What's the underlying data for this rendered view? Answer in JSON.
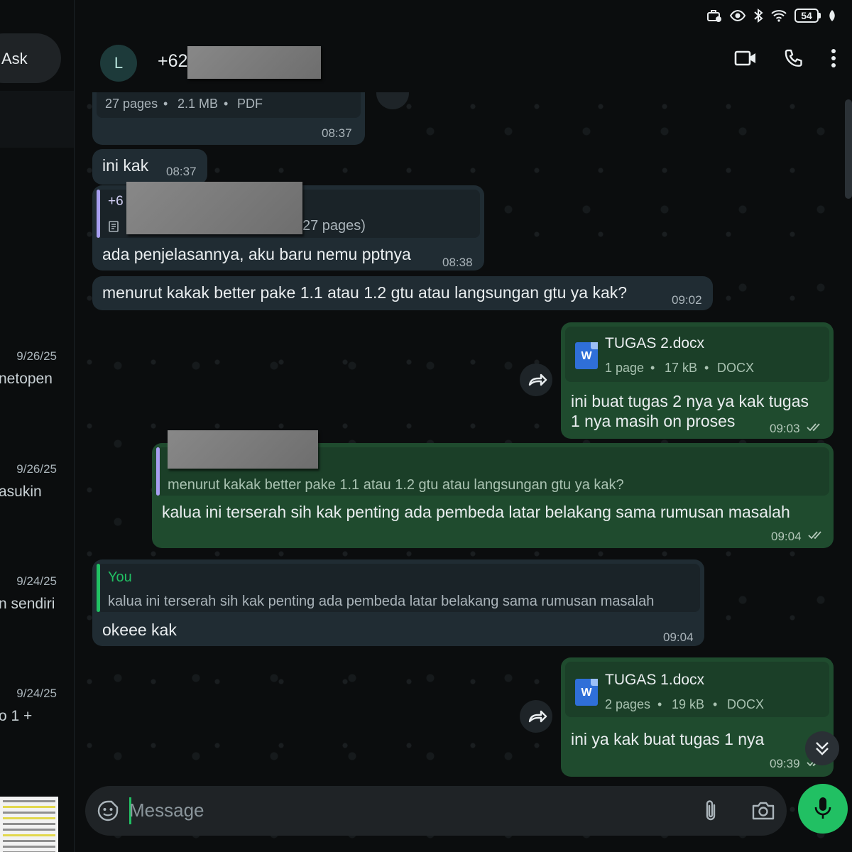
{
  "status_bar": {
    "battery": "54"
  },
  "left_panel": {
    "ask_label": "Ask",
    "chats": [
      {
        "date": "9/26/25",
        "preview": "netopen"
      },
      {
        "date": "9/26/25",
        "preview": "asukin"
      },
      {
        "date": "9/24/25",
        "preview": "n sendiri"
      },
      {
        "date": "9/24/25",
        "preview": "o 1 +"
      }
    ]
  },
  "header": {
    "avatar_letter": "L",
    "contact_name": "+62",
    "icons": [
      "video-call-icon",
      "voice-call-icon",
      "more-options-icon"
    ]
  },
  "messages": {
    "pdf_meta": {
      "pages": "27 pages",
      "size": "2.1 MB",
      "type": "PDF",
      "time": "08:37"
    },
    "ini_kak": {
      "text": "ini kak",
      "time": "08:37"
    },
    "reply_pptnya": {
      "quote_name": "+6",
      "quote_text": "27 pages)",
      "text": "ada penjelasannya, aku baru nemu pptnya",
      "time": "08:38"
    },
    "question": {
      "text": "menurut kakak better pake 1.1 atau 1.2 gtu atau langsungan gtu ya kak?",
      "time": "09:02"
    },
    "tugas2": {
      "file": "TUGAS 2.docx",
      "pages": "1 page",
      "size": "17 kB",
      "type": "DOCX",
      "text_line1": "ini buat tugas 2 nya ya kak tugas",
      "text_line2": "1 nya masih on proses",
      "time": "09:03"
    },
    "reply_terserah": {
      "quote_text": "menurut kakak better pake 1.1 atau 1.2 gtu atau langsungan gtu ya kak?",
      "text": "kalua ini terserah sih kak penting ada pembeda latar belakang sama rumusan masalah",
      "time": "09:04"
    },
    "okeee": {
      "quote_name": "You",
      "quote_text": "kalua ini terserah sih kak penting ada pembeda latar belakang sama rumusan masalah",
      "text": "okeee kak",
      "time": "09:04"
    },
    "tugas1": {
      "file": "TUGAS 1.docx",
      "pages": "2 pages",
      "size": "19 kB",
      "type": "DOCX",
      "text": "ini ya kak buat tugas 1 nya",
      "time": "09:39"
    }
  },
  "input": {
    "placeholder": "Message"
  },
  "colors": {
    "accent": "#21c063",
    "outgoing_bubble": "#1f4b2e",
    "incoming_bubble": "#202c33",
    "background": "#0b0d0e"
  },
  "docx_icon_letter": "W"
}
